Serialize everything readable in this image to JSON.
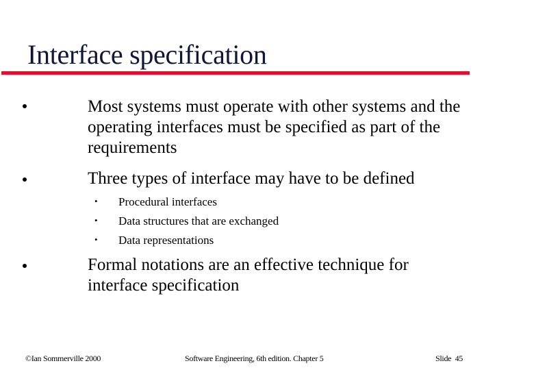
{
  "slide": {
    "title": "Interface specification",
    "bullets": [
      {
        "text": "Most systems must operate with other systems and the operating interfaces must be specified as part of the requirements"
      },
      {
        "text": "Three types of interface may have to be defined",
        "sub": [
          "Procedural interfaces",
          "Data structures that are exchanged",
          "Data representations"
        ]
      },
      {
        "text": "Formal notations are an effective technique for interface specification"
      }
    ],
    "colors": {
      "title": "#10163a",
      "rule": "#e0102f"
    }
  },
  "footer": {
    "copyright": "©Ian Sommerville 2000",
    "book": "Software Engineering, 6th edition. Chapter 5",
    "slide_number": "Slide  45"
  }
}
